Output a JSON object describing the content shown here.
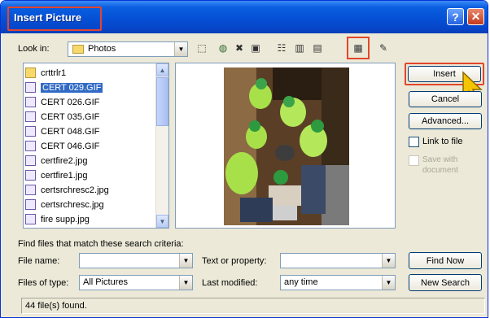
{
  "window": {
    "title": "Insert Picture",
    "help_label": "?",
    "close_label": "✕"
  },
  "toolbar": {
    "look_in_label": "Look in:",
    "look_in_value": "Photos",
    "look_in_arrow": "▼",
    "tools": [
      {
        "icon": "up-folder-icon",
        "glyph": "⬚"
      },
      {
        "icon": "web-icon",
        "glyph": "◍"
      },
      {
        "icon": "delete-icon",
        "glyph": "✖"
      },
      {
        "icon": "new-folder-icon",
        "glyph": "▣"
      },
      {
        "icon": "list-view-icon",
        "glyph": "☷"
      },
      {
        "icon": "details-view-icon",
        "glyph": "▥"
      },
      {
        "icon": "properties-view-icon",
        "glyph": "▤"
      },
      {
        "icon": "preview-view-icon",
        "glyph": "▦"
      },
      {
        "icon": "tools-icon",
        "glyph": "✎"
      }
    ]
  },
  "files": [
    {
      "name": "crttrlr1",
      "type": "folder",
      "selected": false
    },
    {
      "name": "CERT 029.GIF",
      "type": "image",
      "selected": true
    },
    {
      "name": "CERT 026.GIF",
      "type": "image",
      "selected": false
    },
    {
      "name": "CERT 035.GIF",
      "type": "image",
      "selected": false
    },
    {
      "name": "CERT 048.GIF",
      "type": "image",
      "selected": false
    },
    {
      "name": "CERT 046.GIF",
      "type": "image",
      "selected": false
    },
    {
      "name": "certfire2.jpg",
      "type": "image",
      "selected": false
    },
    {
      "name": "certfire1.jpg",
      "type": "image",
      "selected": false
    },
    {
      "name": "certsrchresc2.jpg",
      "type": "image",
      "selected": false
    },
    {
      "name": "certsrchresc.jpg",
      "type": "image",
      "selected": false
    },
    {
      "name": "fire supp.jpg",
      "type": "image",
      "selected": false
    }
  ],
  "scroll": {
    "up": "▲",
    "down": "▼"
  },
  "buttons": {
    "insert": "Insert",
    "cancel": "Cancel",
    "advanced": "Advanced...",
    "find_now": "Find Now",
    "new_search": "New Search"
  },
  "options": {
    "link_to_file": "Link to file",
    "save_with_document_1": "Save with",
    "save_with_document_2": "document"
  },
  "search": {
    "heading": "Find files that match these search criteria:",
    "file_name_label": "File name:",
    "file_name_value": "",
    "file_type_label": "Files of type:",
    "file_type_value": "All Pictures",
    "text_property_label": "Text or property:",
    "text_property_value": "",
    "last_modified_label": "Last modified:",
    "last_modified_value": "any time",
    "arrow": "▼"
  },
  "status": {
    "text": "44 file(s) found."
  },
  "colors": {
    "title_bar": "#0551d6",
    "dialog_bg": "#ece9d8",
    "highlight_frame": "#e3462b",
    "selection": "#316ac5"
  }
}
